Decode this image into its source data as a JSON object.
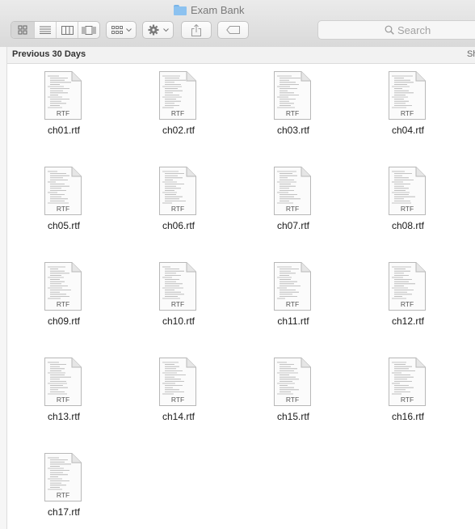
{
  "window": {
    "title": "Exam Bank"
  },
  "toolbar": {
    "view_buttons": [
      "icon-view",
      "list-view",
      "column-view",
      "gallery-view"
    ],
    "arrange_icon": "group-arrange-icon",
    "action_icon": "gear-icon",
    "share_icon": "share-icon",
    "tag_icon": "tag-icon"
  },
  "search": {
    "placeholder": "Search"
  },
  "section": {
    "title": "Previous 30 Days",
    "action_label": "Sh"
  },
  "files": [
    {
      "name": "ch01.rtf",
      "badge": "RTF"
    },
    {
      "name": "ch02.rtf",
      "badge": "RTF"
    },
    {
      "name": "ch03.rtf",
      "badge": "RTF"
    },
    {
      "name": "ch04.rtf",
      "badge": "RTF"
    },
    {
      "name": "ch05.rtf",
      "badge": "RTF"
    },
    {
      "name": "ch06.rtf",
      "badge": "RTF"
    },
    {
      "name": "ch07.rtf",
      "badge": "RTF"
    },
    {
      "name": "ch08.rtf",
      "badge": "RTF"
    },
    {
      "name": "ch09.rtf",
      "badge": "RTF"
    },
    {
      "name": "ch10.rtf",
      "badge": "RTF"
    },
    {
      "name": "ch11.rtf",
      "badge": "RTF"
    },
    {
      "name": "ch12.rtf",
      "badge": "RTF"
    },
    {
      "name": "ch13.rtf",
      "badge": "RTF"
    },
    {
      "name": "ch14.rtf",
      "badge": "RTF"
    },
    {
      "name": "ch15.rtf",
      "badge": "RTF"
    },
    {
      "name": "ch16.rtf",
      "badge": "RTF"
    },
    {
      "name": "ch17.rtf",
      "badge": "RTF"
    }
  ],
  "colors": {
    "toolbar_bg": "#e2e2e2",
    "folder_blue": "#8cc2f0",
    "section_bg": "#f2f2f2"
  }
}
